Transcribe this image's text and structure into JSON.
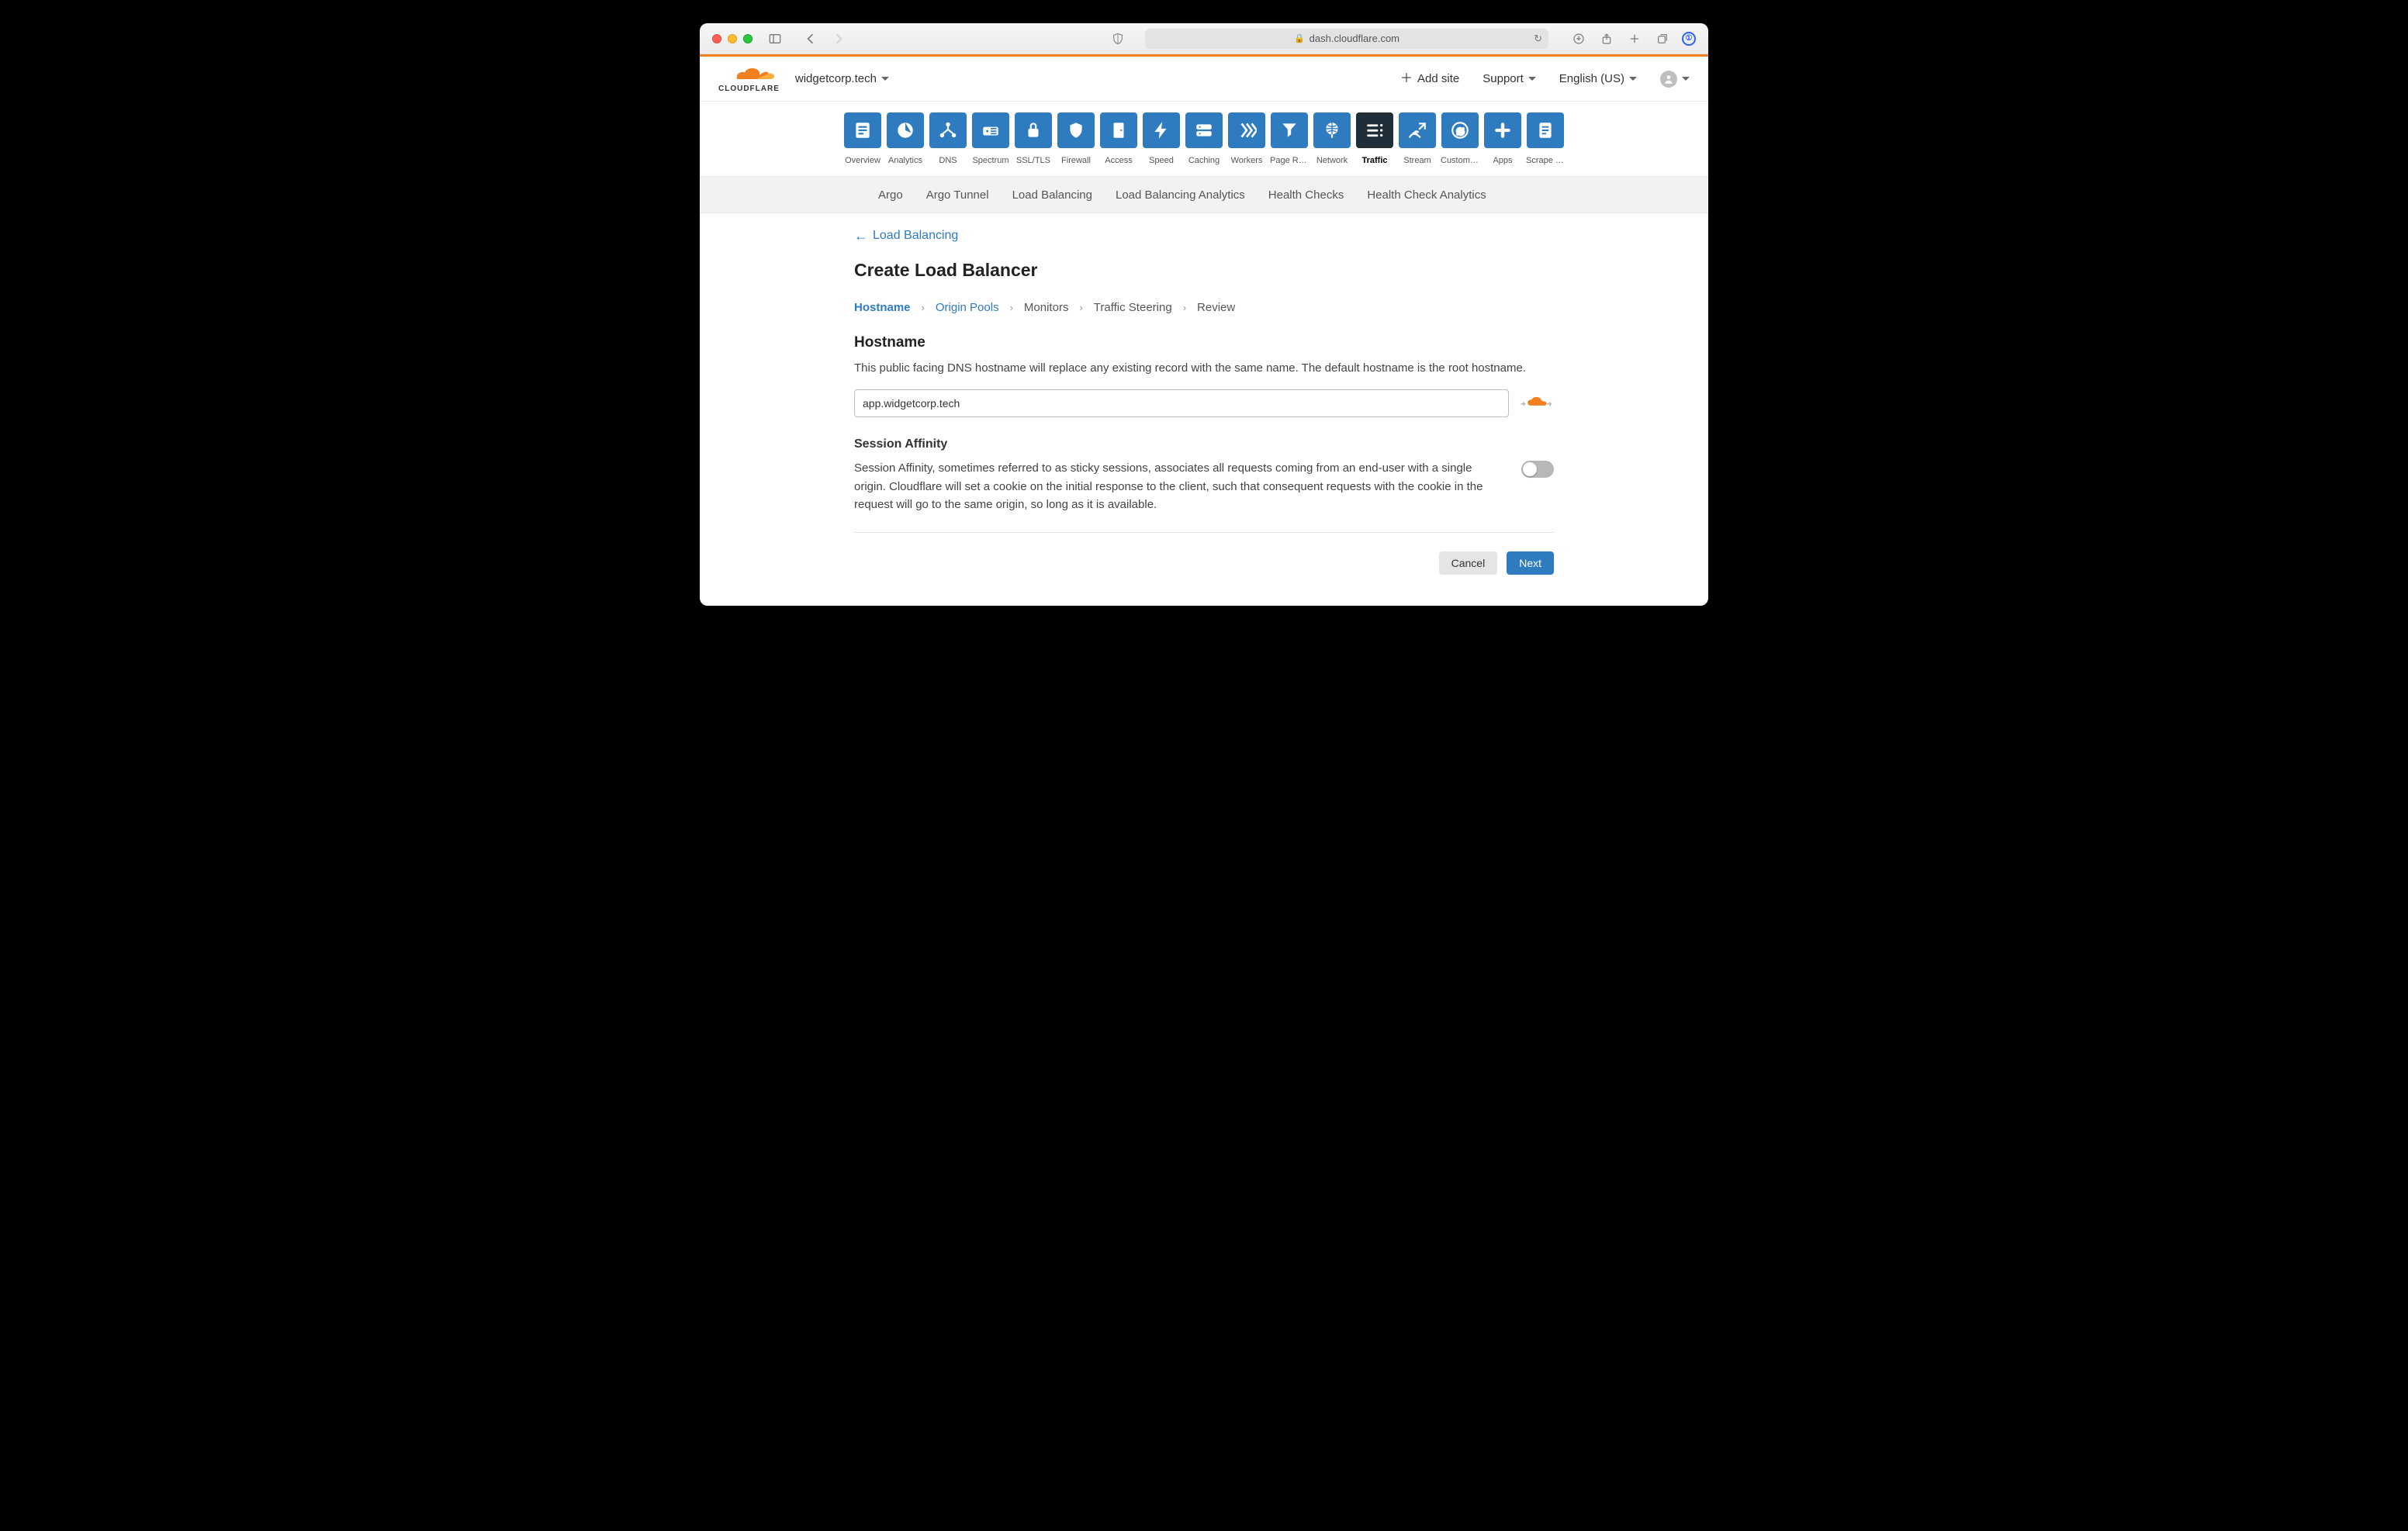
{
  "browser": {
    "url": "dash.cloudflare.com"
  },
  "header": {
    "zone": "widgetcorp.tech",
    "add_site": "Add site",
    "support": "Support",
    "language": "English (US)"
  },
  "nav": [
    {
      "id": "overview",
      "label": "Overview"
    },
    {
      "id": "analytics",
      "label": "Analytics"
    },
    {
      "id": "dns",
      "label": "DNS"
    },
    {
      "id": "spectrum",
      "label": "Spectrum"
    },
    {
      "id": "ssl",
      "label": "SSL/TLS"
    },
    {
      "id": "firewall",
      "label": "Firewall"
    },
    {
      "id": "access",
      "label": "Access"
    },
    {
      "id": "speed",
      "label": "Speed"
    },
    {
      "id": "caching",
      "label": "Caching"
    },
    {
      "id": "workers",
      "label": "Workers"
    },
    {
      "id": "pagerules",
      "label": "Page Rules"
    },
    {
      "id": "network",
      "label": "Network"
    },
    {
      "id": "traffic",
      "label": "Traffic",
      "active": true
    },
    {
      "id": "stream",
      "label": "Stream"
    },
    {
      "id": "customp",
      "label": "Custom P…"
    },
    {
      "id": "apps",
      "label": "Apps"
    },
    {
      "id": "scrape",
      "label": "Scrape S…"
    }
  ],
  "subtabs": [
    "Argo",
    "Argo Tunnel",
    "Load Balancing",
    "Load Balancing Analytics",
    "Health Checks",
    "Health Check Analytics"
  ],
  "back_link": "Load Balancing",
  "page_title": "Create Load Balancer",
  "steps": [
    {
      "label": "Hostname",
      "state": "active"
    },
    {
      "label": "Origin Pools",
      "state": "done"
    },
    {
      "label": "Monitors",
      "state": "todo"
    },
    {
      "label": "Traffic Steering",
      "state": "todo"
    },
    {
      "label": "Review",
      "state": "todo"
    }
  ],
  "hostname": {
    "title": "Hostname",
    "desc": "This public facing DNS hostname will replace any existing record with the same name. The default hostname is the root hostname.",
    "value": "app.widgetcorp.tech"
  },
  "affinity": {
    "title": "Session Affinity",
    "desc": "Session Affinity, sometimes referred to as sticky sessions, associates all requests coming from an end-user with a single origin. Cloudflare will set a cookie on the initial response to the client, such that consequent requests with the cookie in the request will go to the same origin, so long as it is available.",
    "enabled": false
  },
  "buttons": {
    "cancel": "Cancel",
    "next": "Next"
  }
}
